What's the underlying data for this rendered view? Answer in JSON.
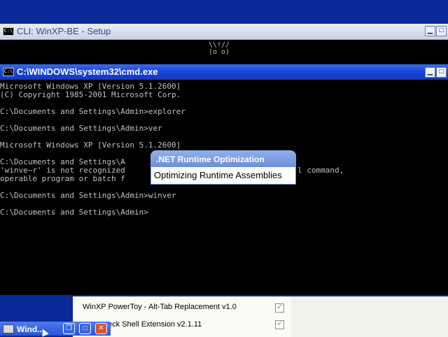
{
  "setup_window": {
    "title": "CLI: WinXP-BE - Setup",
    "ascii_line1": " \\\\!//",
    "ascii_line2": " (o o)"
  },
  "cmd_window": {
    "title": "C:\\WINDOWS\\system32\\cmd.exe",
    "lines": [
      "Microsoft Windows XP [Version 5.1.2600]",
      "(C) Copyright 1985-2001 Microsoft Corp.",
      "",
      "C:\\Documents and Settings\\Admin>explorer",
      "",
      "C:\\Documents and Settings\\Admin>ver",
      "",
      "Microsoft Windows XP [Version 5.1.2600]",
      "",
      "C:\\Documents and Settings\\A",
      "'winve~r' is not recognized",
      "operable program or batch f",
      "",
      "C:\\Documents and Settings\\Admin>winver",
      "",
      "C:\\Documents and Settings\\Admin>"
    ],
    "line10_tail": "l command,"
  },
  "net_popup": {
    "title": ".NET Runtime Optimization",
    "message": "Optimizing Runtime Assemblies"
  },
  "powertoys": {
    "items": [
      {
        "label": "WinXP PowerToy - Alt-Tab Replacement v1.0",
        "checked": true
      },
      {
        "label": "eck Shell Extension v2.1.11",
        "checked": true
      }
    ]
  },
  "taskbar": {
    "window_label": "Wind..."
  }
}
